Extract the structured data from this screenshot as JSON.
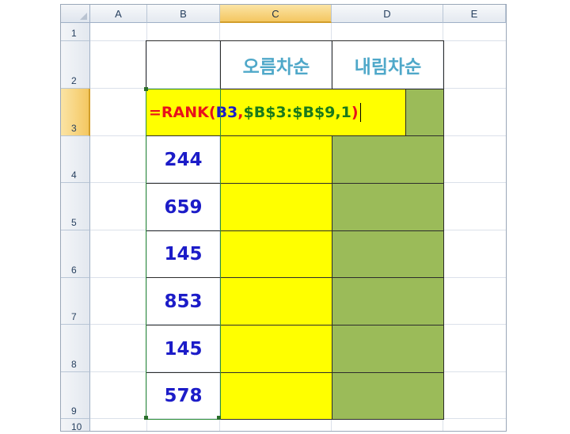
{
  "columns": [
    "A",
    "B",
    "C",
    "D",
    "E"
  ],
  "rows": [
    "1",
    "2",
    "3",
    "4",
    "5",
    "6",
    "7",
    "8",
    "9",
    "10"
  ],
  "selected_column": "C",
  "selected_row": "3",
  "headers": {
    "ascending": "오름차순",
    "descending": "내림차순"
  },
  "formula": {
    "eq": "=RANK(",
    "ref1": "B3",
    "comma": ",",
    "ref2": "$B$3:$B$9,1",
    "close": ")"
  },
  "values": [
    "244",
    "659",
    "145",
    "853",
    "145",
    "578"
  ],
  "colors": {
    "yellow_fill": "#ffff00",
    "green_fill": "#9bbb59",
    "header_text": "#4fa8c9",
    "number_text": "#1c1cc8"
  }
}
